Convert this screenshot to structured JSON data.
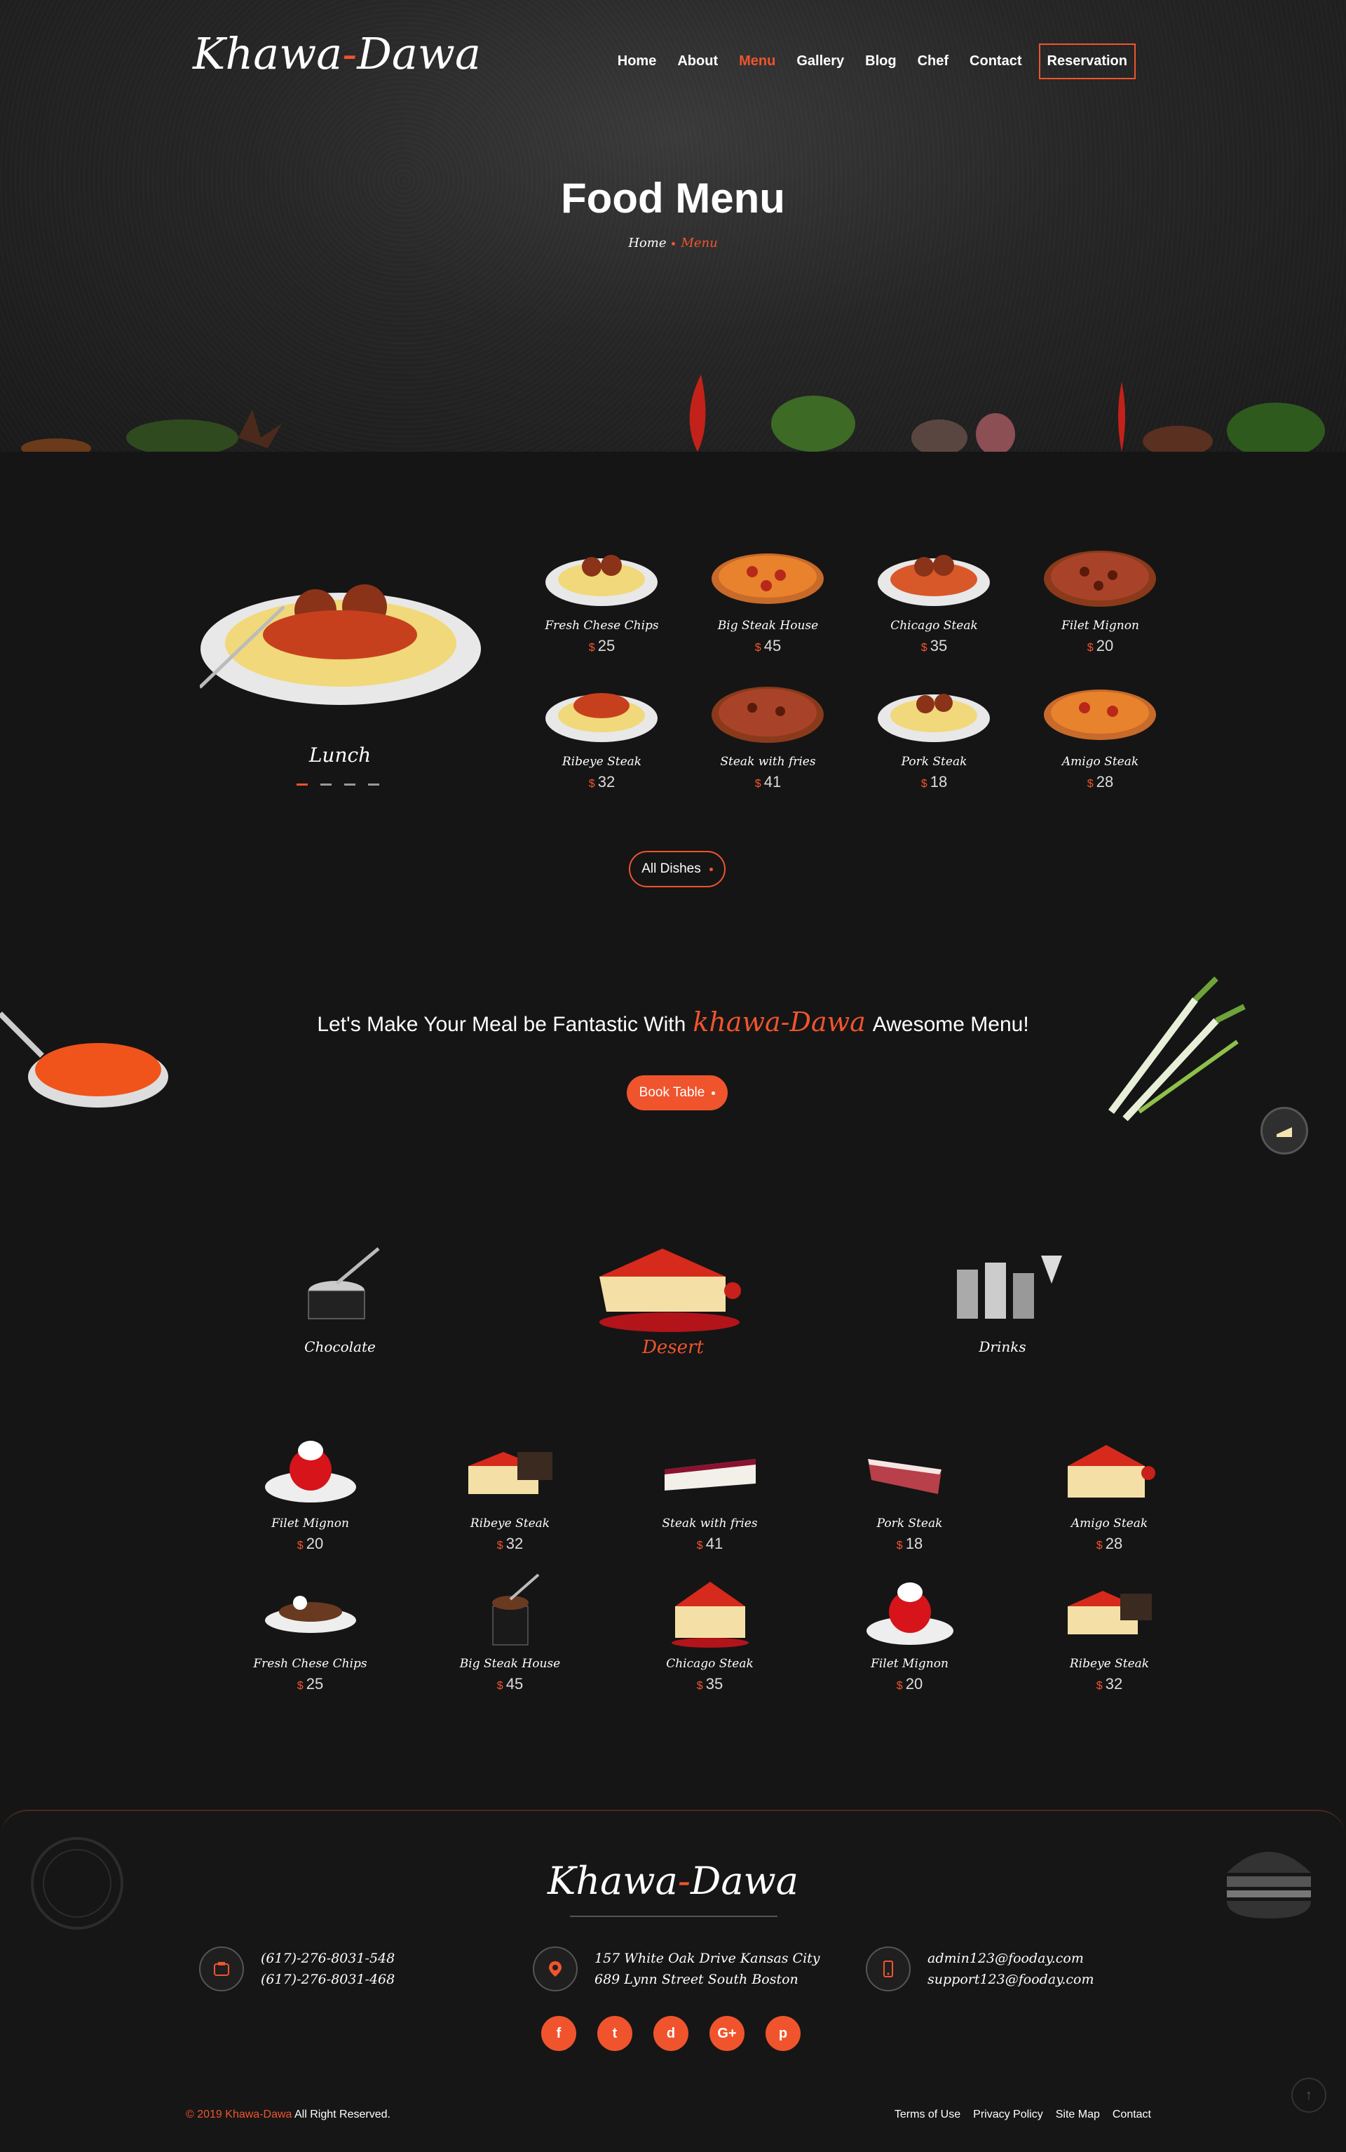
{
  "header": {
    "logo_main": "Khawa",
    "logo_dash": "-",
    "logo_end": "Dawa",
    "nav": [
      "Home",
      "About",
      "Menu",
      "Gallery",
      "Blog",
      "Chef",
      "Contact"
    ],
    "reservation": "Reservation",
    "active_nav": "Menu"
  },
  "hero": {
    "title": "Food Menu",
    "breadcrumb_home": "Home",
    "breadcrumb_current": "Menu"
  },
  "lunch": {
    "label": "Lunch",
    "currency": "$",
    "dishes": [
      {
        "name": "Fresh Chese Chips",
        "price": "25",
        "kind": "spaghetti"
      },
      {
        "name": "Big Steak House",
        "price": "45",
        "kind": "pizza"
      },
      {
        "name": "Chicago Steak",
        "price": "35",
        "kind": "spaghetti"
      },
      {
        "name": "Filet Mignon",
        "price": "20",
        "kind": "pizza-bbq"
      },
      {
        "name": "Ribeye Steak",
        "price": "32",
        "kind": "spaghetti"
      },
      {
        "name": "Steak with fries",
        "price": "41",
        "kind": "pizza-bbq"
      },
      {
        "name": "Pork Steak",
        "price": "18",
        "kind": "spaghetti"
      },
      {
        "name": "Amigo Steak",
        "price": "28",
        "kind": "pizza"
      }
    ],
    "all_dishes": "All Dishes"
  },
  "cta": {
    "text_before": "Let's Make Your Meal be Fantastic With",
    "brand": "khawa-Dawa",
    "text_after": "Awesome Menu!",
    "button": "Book Table"
  },
  "categories": [
    {
      "label": "Chocolate",
      "active": false
    },
    {
      "label": "Desert",
      "active": true
    },
    {
      "label": "Drinks",
      "active": false
    }
  ],
  "desserts": {
    "currency": "$",
    "items": [
      {
        "name": "Filet Mignon",
        "price": "20"
      },
      {
        "name": "Ribeye Steak",
        "price": "32"
      },
      {
        "name": "Steak with fries",
        "price": "41"
      },
      {
        "name": "Pork Steak",
        "price": "18"
      },
      {
        "name": "Amigo Steak",
        "price": "28"
      },
      {
        "name": "Fresh Chese Chips",
        "price": "25"
      },
      {
        "name": "Big Steak House",
        "price": "45"
      },
      {
        "name": "Chicago Steak",
        "price": "35"
      },
      {
        "name": "Filet Mignon",
        "price": "20"
      },
      {
        "name": "Ribeye Steak",
        "price": "32"
      }
    ]
  },
  "footer": {
    "logo_main": "Khawa",
    "logo_dash": "-",
    "logo_end": "Dawa",
    "phone1": "(617)-276-8031-548",
    "phone2": "(617)-276-8031-468",
    "address1": "157 White Oak Drive Kansas City",
    "address2": "689 Lynn Street South Boston",
    "email1": "admin123@fooday.com",
    "email2": "support123@fooday.com",
    "socials": [
      "f",
      "t",
      "d",
      "G+",
      "p"
    ],
    "copyright_year": "© 2019",
    "copyright_brand": "Khawa-Dawa",
    "copyright_rest": "All Right Reserved.",
    "links": [
      "Terms of Use",
      "Privacy Policy",
      "Site Map",
      "Contact"
    ]
  },
  "colors": {
    "accent": "#f0542d",
    "background": "#151515"
  }
}
